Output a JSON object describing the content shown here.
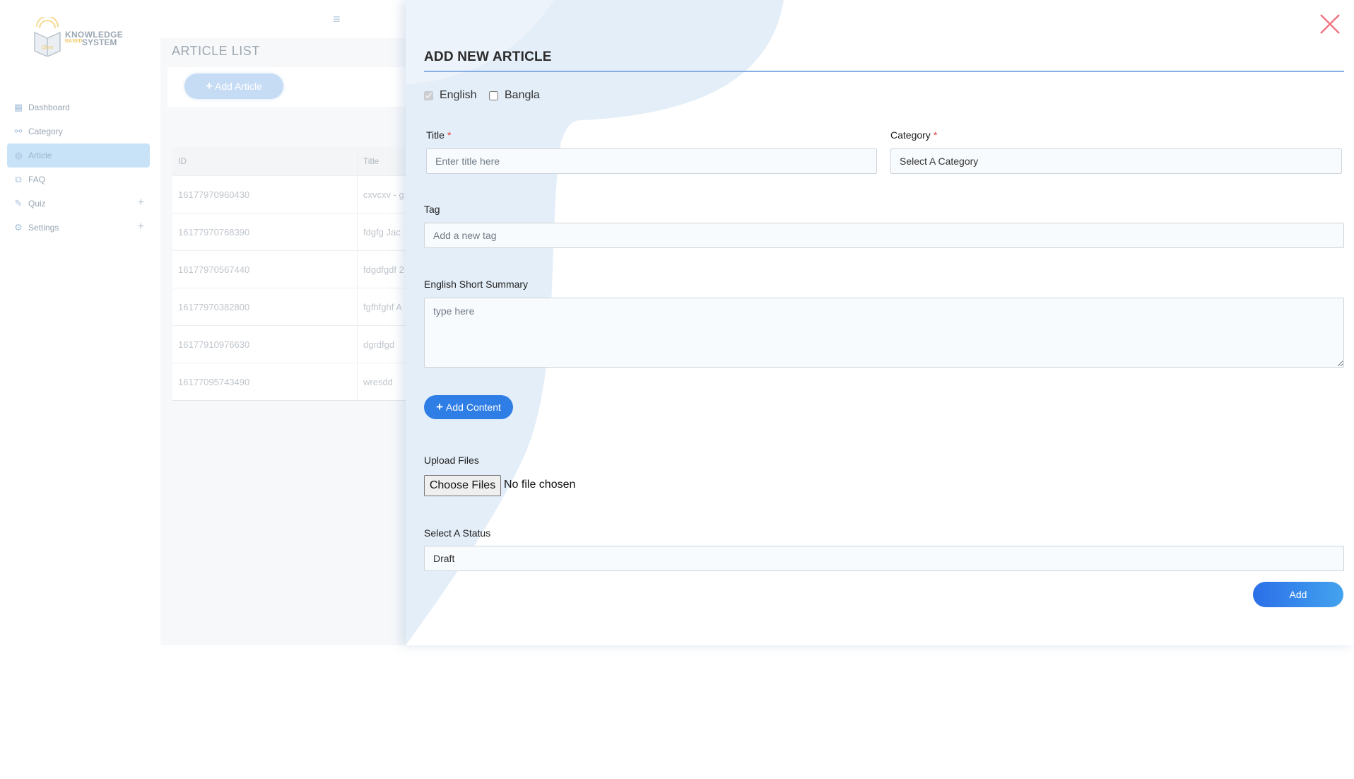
{
  "app": {
    "logo": {
      "line1": "KNOWLEDGE",
      "line2_small": "BASED",
      "line2": "SYSTEM"
    },
    "sidebar": {
      "items": [
        {
          "label": "Dashboard",
          "icon": "dashboard-icon",
          "active": false
        },
        {
          "label": "Category",
          "icon": "category-icon",
          "active": false
        },
        {
          "label": "Article",
          "icon": "globe-icon",
          "active": true
        },
        {
          "label": "FAQ",
          "icon": "faq-icon",
          "active": false
        },
        {
          "label": "Quiz",
          "icon": "quiz-icon",
          "active": false,
          "expandable": true
        },
        {
          "label": "Settings",
          "icon": "gear-icon",
          "active": false,
          "expandable": true
        }
      ]
    },
    "page_title": "ARTICLE LIST",
    "add_article_label": "Add Article",
    "table": {
      "columns": [
        "ID",
        "Title"
      ],
      "rows": [
        {
          "id": "16177970960430",
          "title": "cxvcxv - g"
        },
        {
          "id": "16177970768390",
          "title": "fdgfg Jac"
        },
        {
          "id": "16177970567440",
          "title": "fdgdfgdf 2"
        },
        {
          "id": "16177970382800",
          "title": "fgfhfghf A"
        },
        {
          "id": "16177910976630",
          "title": "dgrdfgd"
        },
        {
          "id": "16177095743490",
          "title": "wresdd"
        }
      ]
    }
  },
  "drawer": {
    "title": "ADD NEW ARTICLE",
    "languages": [
      {
        "label": "English",
        "checked": true,
        "disabled": true
      },
      {
        "label": "Bangla",
        "checked": false,
        "disabled": false
      }
    ],
    "title_field": {
      "label": "Title",
      "required_mark": "*",
      "placeholder": "Enter title here",
      "value": ""
    },
    "category_field": {
      "label": "Category",
      "required_mark": "*",
      "selected": "Select A Category"
    },
    "tag_field": {
      "label": "Tag",
      "placeholder": "Add a new tag"
    },
    "summary_field": {
      "label": "English Short Summary",
      "placeholder": "type here"
    },
    "add_content_label": "Add Content",
    "upload": {
      "label": "Upload Files",
      "button": "Choose Files",
      "status": "No file chosen"
    },
    "status_field": {
      "label": "Select A Status",
      "selected": "Draft"
    },
    "submit_label": "Add"
  },
  "colors": {
    "accent": "#2f7ee6",
    "close": "#f0737f",
    "underline": "#86aee6",
    "required": "#e53b3b"
  }
}
